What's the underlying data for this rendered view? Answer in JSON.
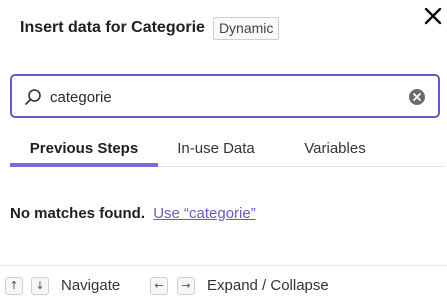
{
  "header": {
    "title": "Insert data for Categorie",
    "badge": "Dynamic",
    "close_icon": "close-icon"
  },
  "search": {
    "value": "categorie",
    "icon": "search-icon",
    "clear_icon": "clear-circle-icon"
  },
  "tabs": [
    {
      "label": "Previous Steps",
      "active": true
    },
    {
      "label": "In-use Data",
      "active": false
    },
    {
      "label": "Variables",
      "active": false
    }
  ],
  "results": {
    "empty_text": "No matches found.",
    "use_link": "Use “categorie”"
  },
  "footer": {
    "up_key": "↑",
    "down_key": "↓",
    "navigate_label": "Navigate",
    "left_key": "←",
    "right_key": "→",
    "expand_label": "Expand / Collapse"
  },
  "colors": {
    "accent": "#6d55c8",
    "link": "#6a59c9",
    "tab_underline": "#7c6ad6"
  }
}
